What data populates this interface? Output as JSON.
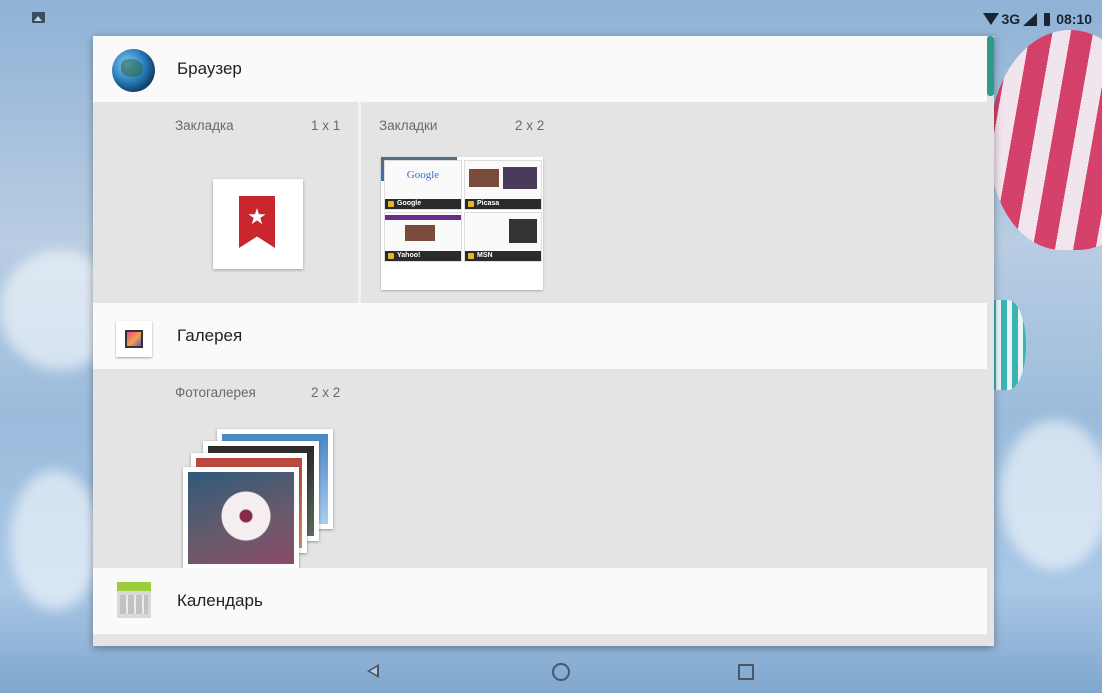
{
  "status_bar": {
    "network": "3G",
    "time": "08:10"
  },
  "apps": [
    {
      "name": "Браузер",
      "icon": "globe-icon",
      "widgets": [
        {
          "label": "Закладка",
          "size": "1 x 1"
        },
        {
          "label": "Закладки",
          "size": "2 x 2",
          "thumbnails": [
            "Google",
            "Picasa",
            "Yahoo!",
            "MSN"
          ],
          "thumbnail_heading": "Google"
        }
      ]
    },
    {
      "name": "Галерея",
      "icon": "gallery-icon",
      "widgets": [
        {
          "label": "Фотогалерея",
          "size": "2 x 2"
        }
      ]
    },
    {
      "name": "Календарь",
      "icon": "calendar-icon",
      "widgets": []
    }
  ],
  "navigation": {
    "buttons": [
      "back",
      "home",
      "recents"
    ]
  },
  "colors": {
    "panel": "#e4e4e4",
    "header": "#fafafa",
    "scroll_indicator": "#2a9c87",
    "bookmark_red": "#c9262e"
  }
}
